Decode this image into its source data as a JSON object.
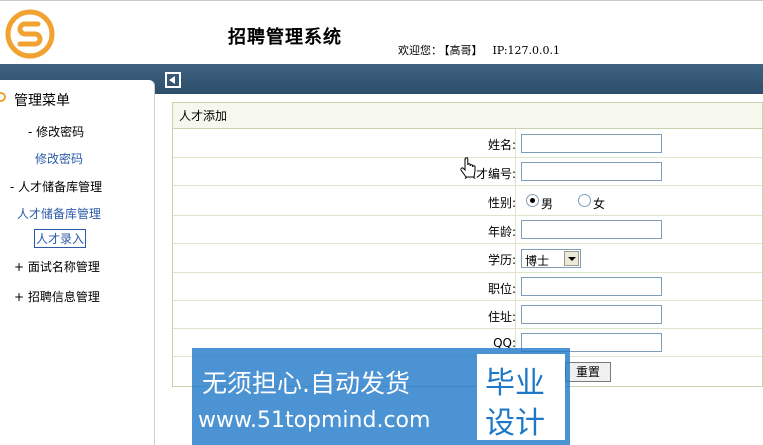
{
  "header": {
    "title": "招聘管理系统",
    "welcome_label": "欢迎您：",
    "user": "【高哥】",
    "ip": "IP:127.0.0.1"
  },
  "sidebar": {
    "title": "管理菜单",
    "items": [
      {
        "label": "- 修改密码"
      },
      {
        "label": "修改密码"
      },
      {
        "label": "- 人才储备库管理"
      },
      {
        "label": "人才储备库管理"
      },
      {
        "label": "人才录入"
      },
      {
        "label": "+ 面试名称管理"
      },
      {
        "label": "+ 招聘信息管理"
      }
    ]
  },
  "form": {
    "title": "人才添加",
    "name_label": "姓名:",
    "number_label": "人才编号:",
    "gender_label": "性别:",
    "gender_male": "男",
    "gender_female": "女",
    "gender_selected": "男",
    "age_label": "年龄:",
    "education_label": "学历:",
    "education_value": "博士",
    "position_label": "职位:",
    "address_label": "住址:",
    "qq_label": "QQ:",
    "reset_label": "重置"
  },
  "watermark": {
    "line1": "无须担心.自动发货",
    "line2": "www.51topmind.com",
    "badge_top": "毕业",
    "badge_bottom": "设计"
  },
  "colors": {
    "bar": "#2c4e6b",
    "logo": "#f2a230",
    "link": "#2a5aa8",
    "watermark": "#1e78c8"
  }
}
